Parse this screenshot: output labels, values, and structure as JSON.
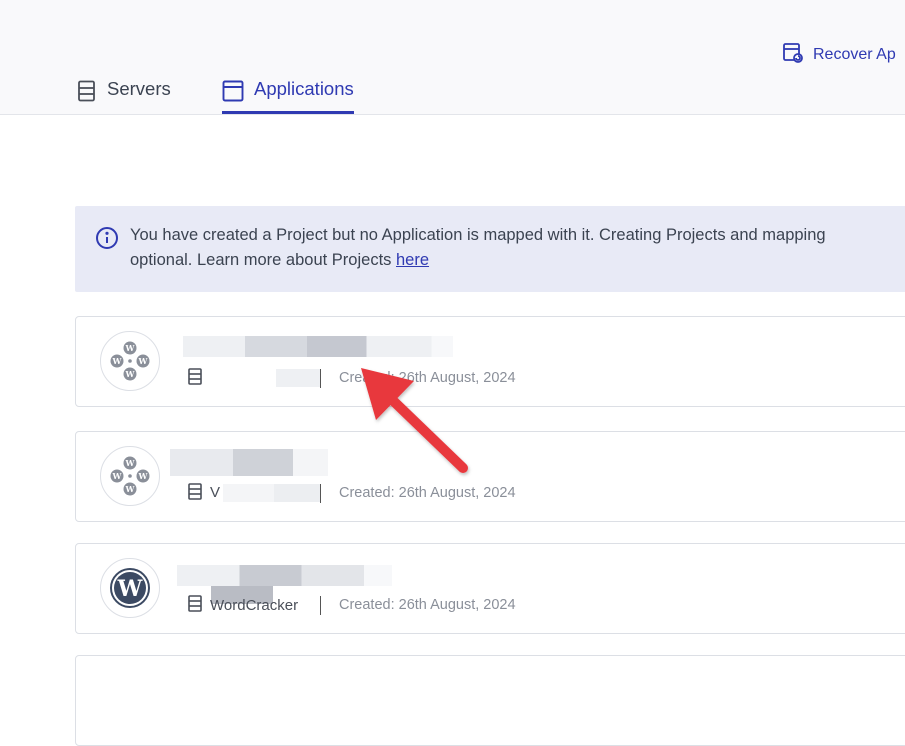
{
  "header": {
    "recover_label": "Recover Ap",
    "tabs": [
      {
        "label": "Servers",
        "active": false
      },
      {
        "label": "Applications",
        "active": true
      }
    ]
  },
  "banner": {
    "line1": "You have created a Project but no Application is mapped with it. Creating Projects and mapping",
    "line2_prefix": "optional. Learn more about Projects",
    "link_text": "here"
  },
  "apps": [
    {
      "icon": "wordpress-multisite-icon",
      "server": "",
      "created": "Created: 26th August, 2024"
    },
    {
      "icon": "wordpress-multisite-icon",
      "server": "V",
      "created": "Created: 26th August, 2024"
    },
    {
      "icon": "wordpress-icon",
      "server": "WordCracker",
      "created": "Created: 26th August, 2024"
    }
  ],
  "colors": {
    "accent": "#2f3ab2",
    "arrow": "#e8383d",
    "banner_bg": "#e8eaf6"
  }
}
